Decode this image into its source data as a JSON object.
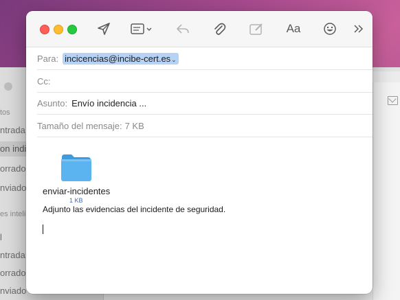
{
  "background_app": {
    "sidebar_items": [
      {
        "label": "tos",
        "kind": "section"
      },
      {
        "label": "ntrada",
        "kind": "item"
      },
      {
        "label": "on indi",
        "kind": "selected"
      },
      {
        "label": "orrador",
        "kind": "item"
      },
      {
        "label": "nviado",
        "kind": "item"
      },
      {
        "label": "es inteli",
        "kind": "section"
      },
      {
        "label": "l",
        "kind": "item"
      },
      {
        "label": "ntrada",
        "kind": "item"
      },
      {
        "label": "orrador",
        "kind": "item"
      },
      {
        "label": "nviado",
        "kind": "item"
      }
    ]
  },
  "toolbar": {
    "icons": [
      "send-icon",
      "header-fields-icon",
      "reply-icon",
      "attach-icon",
      "markup-icon",
      "format-icon",
      "emoji-icon",
      "more-icon"
    ],
    "format_label": "Aa",
    "traffic_lights": {
      "close": "#fe5f57",
      "minimize": "#febc2e",
      "zoom": "#28c840"
    }
  },
  "fields": {
    "to_label": "Para:",
    "to_value": "incicencias@incibe-cert.es",
    "to_caret": "⌄",
    "cc_label": "Cc:",
    "subject_label": "Asunto:",
    "subject_value": "Envío incidencia ...",
    "size_label": "Tamaño del mensaje:",
    "size_value": "7 KB"
  },
  "attachment": {
    "name": "enviar-incidentes",
    "size": "1 KB",
    "icon": "folder-icon",
    "color": "#5bb4f0"
  },
  "body": {
    "text": "Adjunto las evidencias del incidente de seguridad."
  }
}
